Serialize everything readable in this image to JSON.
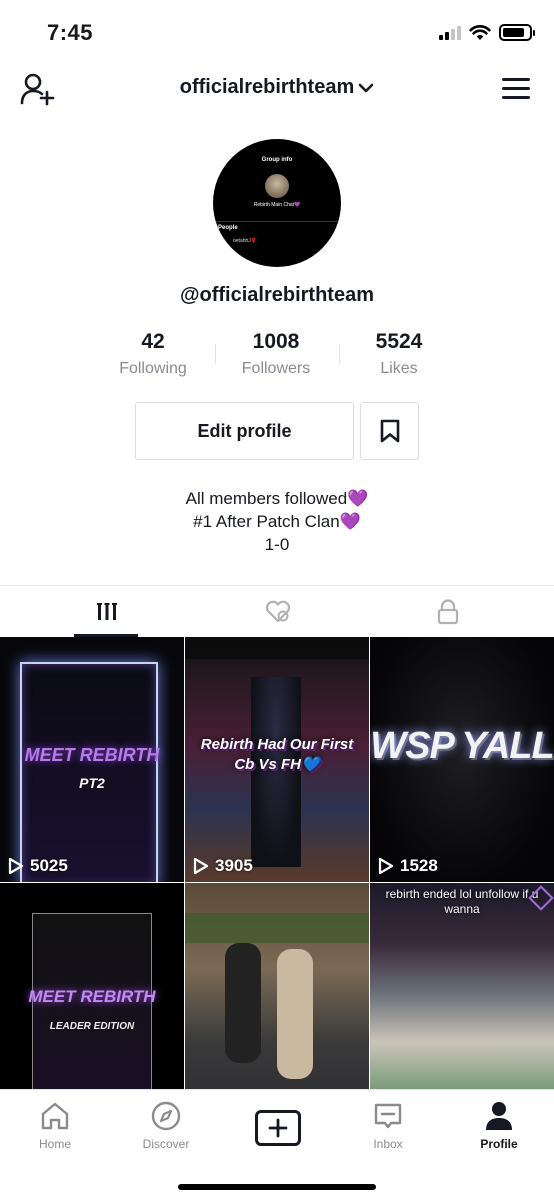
{
  "status_bar": {
    "time": "7:45",
    "battery_level": 0.85
  },
  "header": {
    "username": "officialrebirthteam"
  },
  "avatar": {
    "group_label": "Group info",
    "chat_name": "Rebirth Main Chat💜",
    "people_label": "People",
    "member": "oetahhJ🌹"
  },
  "profile": {
    "handle": "@officialrebirthteam"
  },
  "stats": [
    {
      "value": "42",
      "label": "Following"
    },
    {
      "value": "1008",
      "label": "Followers"
    },
    {
      "value": "5524",
      "label": "Likes"
    }
  ],
  "actions": {
    "edit_profile": "Edit profile"
  },
  "bio": {
    "line1": "All members followed",
    "line2": "#1 After Patch Clan",
    "line3": "1-0",
    "emoji": "💜"
  },
  "videos": [
    {
      "title": "MEET REBIRTH",
      "subtitle": "PT2",
      "views": "5025"
    },
    {
      "title": "Rebirth Had Our First Cb Vs FH💙",
      "views": "3905"
    },
    {
      "title": "WSP YALL",
      "views": "1528"
    },
    {
      "title": "MEET REBIRTH",
      "subtitle": "LEADER EDITION",
      "views": ""
    },
    {
      "title": "",
      "views": ""
    },
    {
      "title": "rebirth ended lol unfollow if u wanna",
      "views": ""
    }
  ],
  "bottom_nav": {
    "home": "Home",
    "discover": "Discover",
    "inbox": "Inbox",
    "profile": "Profile"
  },
  "colors": {
    "accent_purple": "#9b3fe8",
    "text": "#161823",
    "muted": "#8a8b91"
  }
}
